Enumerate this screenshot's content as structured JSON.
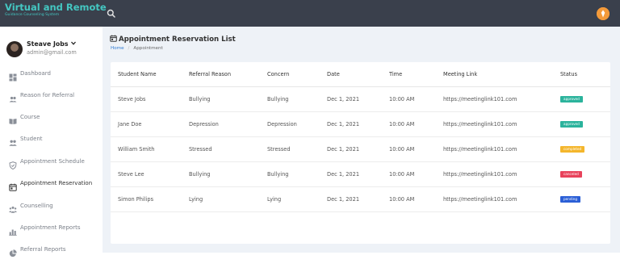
{
  "brand": {
    "title": "Virtual and Remote",
    "subtitle": "Guidance Counseling System"
  },
  "sidebar": {
    "profile": {
      "name": "Steave Jobs",
      "email": "admin@gmail.com"
    },
    "items": [
      {
        "label": "Dashboard"
      },
      {
        "label": "Reason for Referral"
      },
      {
        "label": "Course"
      },
      {
        "label": "Student"
      },
      {
        "label": "Appointment Schedule"
      },
      {
        "label": "Appointment Reservation"
      },
      {
        "label": "Counselling"
      },
      {
        "label": "Appointment Reports"
      },
      {
        "label": "Referral Reports"
      }
    ]
  },
  "main": {
    "title": "Appointment Reservation List",
    "breadcrumb": {
      "home": "Home",
      "current": "Appointment"
    },
    "table": {
      "headers": [
        "Student Name",
        "Referral Reason",
        "Concern",
        "Date",
        "Time",
        "Meeting Link",
        "Status"
      ],
      "rows": [
        {
          "name": "Steve Jobs",
          "reason": "Bullying",
          "concern": "Bullying",
          "date": "Dec 1, 2021",
          "time": "10:00 AM",
          "link": "https://meetinglink101.com",
          "status": "approved"
        },
        {
          "name": "Jane Doe",
          "reason": "Depression",
          "concern": "Depression",
          "date": "Dec 1, 2021",
          "time": "10:00 AM",
          "link": "https://meetinglink101.com",
          "status": "approved"
        },
        {
          "name": "William Smith",
          "reason": "Stressed",
          "concern": "Stressed",
          "date": "Dec 1, 2021",
          "time": "10:00 AM",
          "link": "https://meetinglink101.com",
          "status": "completed"
        },
        {
          "name": "Steve Lee",
          "reason": "Bullying",
          "concern": "Bullying",
          "date": "Dec 1, 2021",
          "time": "10:00 AM",
          "link": "https://meetinglink101.com",
          "status": "canceled"
        },
        {
          "name": "Simon Philips",
          "reason": "Lying",
          "concern": "Lying",
          "date": "Dec 1, 2021",
          "time": "10:00 AM",
          "link": "https://meetinglink101.com",
          "status": "pending"
        }
      ]
    }
  },
  "colors": {
    "topbar": "#3a404c",
    "brand": "#44c7c2",
    "approved": "#2bb39c",
    "completed": "#f4b62c",
    "canceled": "#e8425b",
    "pending": "#2b5fd6"
  }
}
